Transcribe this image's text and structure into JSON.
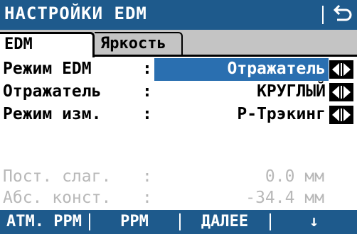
{
  "header": {
    "title": "НАСТРОЙКИ EDM",
    "back_icon": "return-arrow-icon"
  },
  "tabs": [
    {
      "label": "EDM",
      "active": true
    },
    {
      "label": "Яркость",
      "active": false
    }
  ],
  "fields": [
    {
      "label": "Режим EDM",
      "colon": ":",
      "value": "Отражатель",
      "selected": true
    },
    {
      "label": "Отражатель",
      "colon": ":",
      "value": "КРУГЛЫЙ",
      "selected": false
    },
    {
      "label": "Режим изм.",
      "colon": ":",
      "value": "Р-Трэкинг",
      "selected": false
    }
  ],
  "readonly_fields": [
    {
      "label": "Пост. слаг.",
      "colon": ":",
      "value": "0.0 мм"
    },
    {
      "label": "Абс. конст.",
      "colon": ":",
      "value": "-34.4 мм"
    }
  ],
  "softkeys": [
    {
      "label": "АТМ. PPM"
    },
    {
      "label": "PPM"
    },
    {
      "label": "ДАЛЕЕ"
    },
    {
      "label": "↓"
    }
  ],
  "colors": {
    "titlebar": "#1e5a8c",
    "selection": "#2a6fb0",
    "tabstrip": "#c4c4c4",
    "muted_text": "#b8b8b8"
  }
}
